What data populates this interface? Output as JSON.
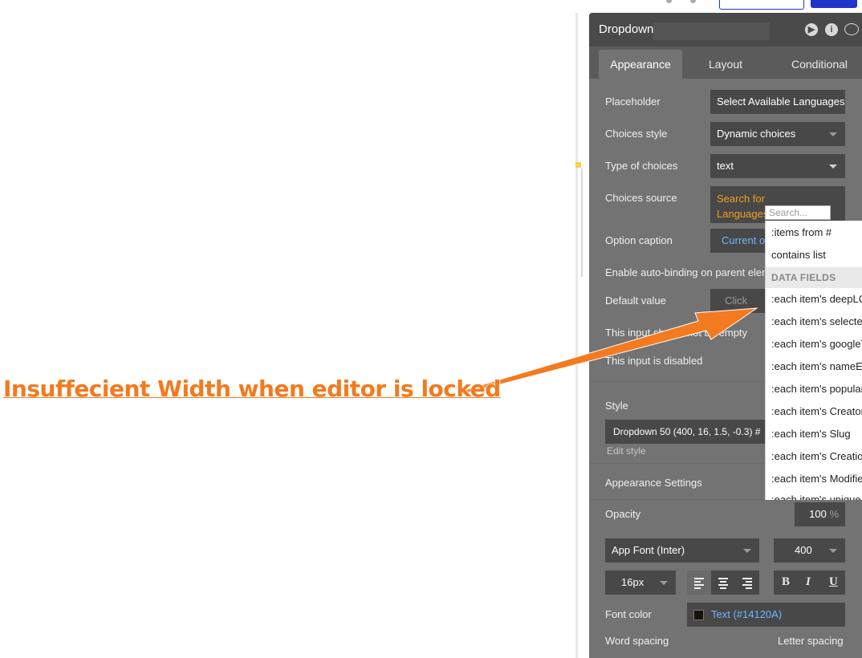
{
  "annotation": {
    "text": "Insuffecient Width when editor is locked",
    "color": "#f37a1f"
  },
  "panel": {
    "title": "Dropdown",
    "header_icons": [
      "play-icon",
      "info-icon",
      "comment-icon"
    ],
    "tabs": [
      {
        "label": "Appearance",
        "active": true
      },
      {
        "label": "Layout",
        "active": false
      },
      {
        "label": "Conditional",
        "active": false
      }
    ],
    "rows": {
      "placeholder": {
        "label": "Placeholder",
        "value": "Select Available Languages"
      },
      "choices_style": {
        "label": "Choices style",
        "value": "Dynamic choices"
      },
      "type_of_choices": {
        "label": "Type of choices",
        "value": "text"
      },
      "choices_source": {
        "label": "Choices source",
        "value_line1": "Search for",
        "value_line2": "Languages"
      },
      "option_caption": {
        "label": "Option caption",
        "value": "Current o"
      },
      "auto_binding": {
        "label": "Enable auto-binding on parent elem"
      },
      "default_value": {
        "label": "Default value",
        "value": "Click"
      },
      "not_empty": {
        "label": "This input should not be empty"
      },
      "disabled": {
        "label": "This input is disabled"
      }
    },
    "style": {
      "label": "Style",
      "value": "Dropdown 50 (400, 16, 1.5, -0.3) #",
      "edit_link": "Edit style"
    },
    "appearance_settings": {
      "label": "Appearance Settings"
    },
    "opacity": {
      "label": "Opacity",
      "value": "100",
      "unit": "%"
    },
    "font": {
      "family": "App Font (Inter)",
      "weight": "400",
      "size": "16px"
    },
    "format_buttons": {
      "bold": "B",
      "italic": "I",
      "underline": "U"
    },
    "font_color": {
      "label": "Font color",
      "value": "Text (#14120A)",
      "swatch": "#14120A"
    },
    "spacing": {
      "word": "Word spacing",
      "letter": "Letter spacing"
    }
  },
  "dropdown": {
    "search_placeholder": "Search...",
    "items_top": [
      ":items from #",
      "contains list"
    ],
    "section_header": "DATA FIELDS",
    "items": [
      ":each item's deepLC",
      ":each item's selectec",
      ":each item's googleT",
      ":each item's nameEr",
      ":each item's popular",
      ":each item's Creator",
      ":each item's Slug",
      ":each item's Creatior",
      ":each item's Modifie",
      ":each item's unique"
    ]
  },
  "colors": {
    "panel_bg": "#5b5b5b",
    "field_bg": "#484848",
    "accent_orange": "#f0a020",
    "accent_blue": "#6fb4ff",
    "toolbar_blue": "#1f35c9"
  }
}
